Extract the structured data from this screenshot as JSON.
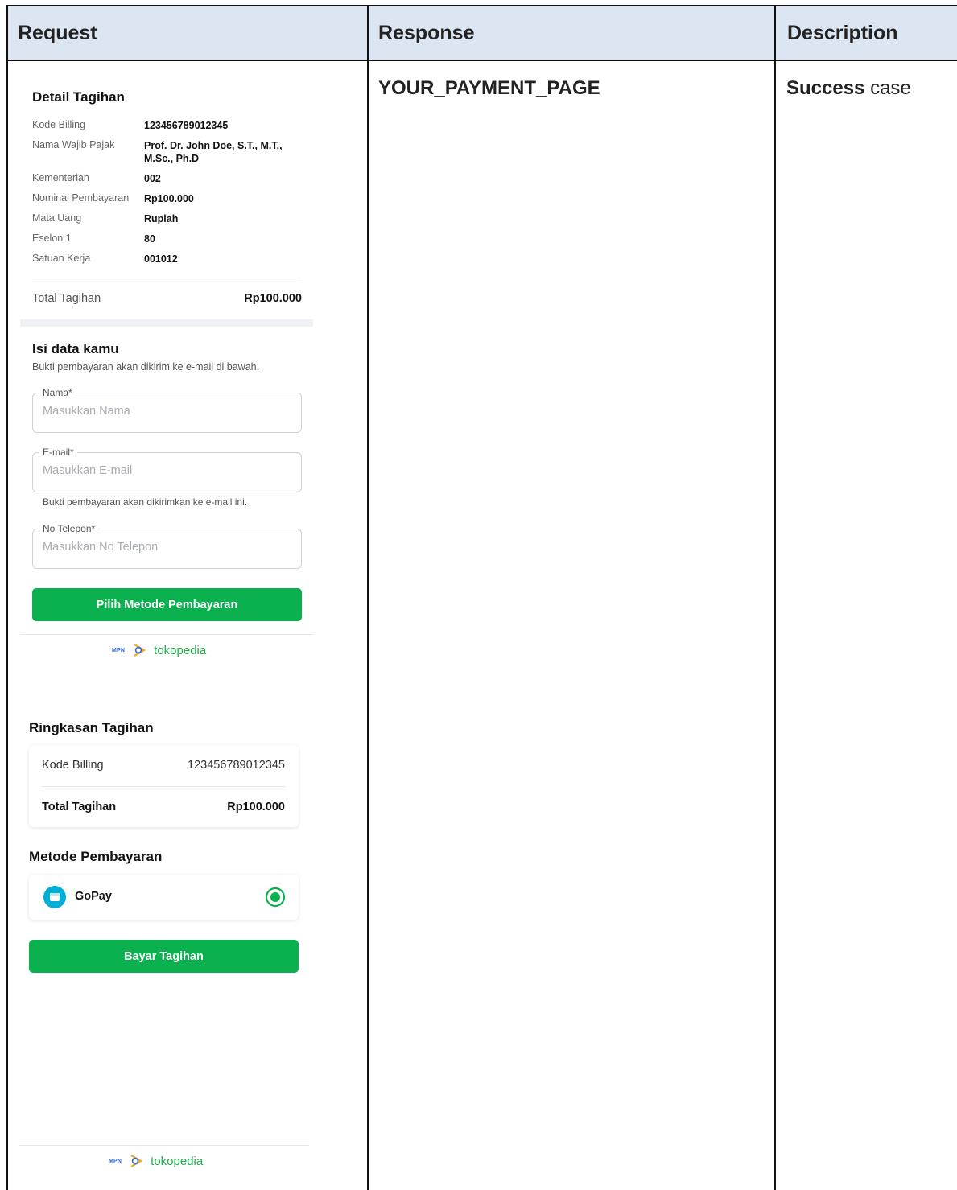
{
  "headers": {
    "request": "Request",
    "response": "Response",
    "description": "Description"
  },
  "response": {
    "value": "YOUR_PAYMENT_PAGE"
  },
  "description": {
    "strong": "Success",
    "rest": " case"
  },
  "detail": {
    "title": "Detail Tagihan",
    "rows": [
      {
        "label": "Kode Billing",
        "value": "123456789012345"
      },
      {
        "label": "Nama Wajib Pajak",
        "value": "Prof. Dr. John Doe, S.T., M.T.,",
        "value2": "M.Sc., Ph.D"
      },
      {
        "label": "Kementerian",
        "value": "002"
      },
      {
        "label": "Nominal Pembayaran",
        "value": "Rp100.000"
      },
      {
        "label": "Mata Uang",
        "value": "Rupiah"
      },
      {
        "label": "Eselon 1",
        "value": "80"
      },
      {
        "label": "Satuan Kerja",
        "value": "001012"
      }
    ],
    "total_label": "Total Tagihan",
    "total_value": "Rp100.000"
  },
  "form": {
    "title": "Isi data kamu",
    "subtitle": "Bukti pembayaran akan dikirim ke e-mail di bawah.",
    "name_label": "Nama*",
    "name_placeholder": "Masukkan Nama",
    "email_label": "E-mail*",
    "email_placeholder": "Masukkan E-mail",
    "email_hint": "Bukti pembayaran akan dikirimkan ke e-mail ini.",
    "phone_label": "No Telepon*",
    "phone_placeholder": "Masukkan No Telepon",
    "submit": "Pilih Metode Pembayaran"
  },
  "brand": {
    "mpn": "MPN",
    "toko": "tokopedia"
  },
  "summary": {
    "title": "Ringkasan Tagihan",
    "billing_label": "Kode Billing",
    "billing_value": "123456789012345",
    "total_label": "Total Tagihan",
    "total_value": "Rp100.000"
  },
  "payment": {
    "title": "Metode Pembayaran",
    "method": "GoPay",
    "button": "Bayar Tagihan"
  },
  "colors": {
    "header_bg": "#dce6f2",
    "green": "#0bb04f",
    "gopay": "#00aed6"
  }
}
